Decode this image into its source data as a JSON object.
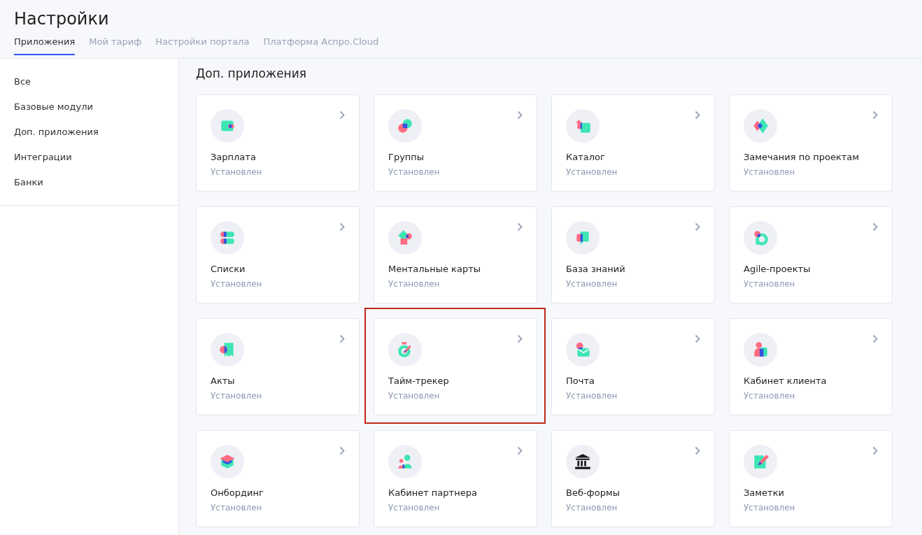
{
  "page_title": "Настройки",
  "tabs": [
    {
      "label": "Приложения",
      "selected": true
    },
    {
      "label": "Мой тариф",
      "selected": false
    },
    {
      "label": "Настройки портала",
      "selected": false
    },
    {
      "label": "Платформа Аспро.Cloud",
      "selected": false
    }
  ],
  "sidebar": {
    "items": [
      {
        "label": "Все",
        "selected": false
      },
      {
        "label": "Базовые модули",
        "selected": false
      },
      {
        "label": "Доп. приложения",
        "selected": false
      },
      {
        "label": "Интеграции",
        "selected": false
      },
      {
        "label": "Банки",
        "selected": false
      }
    ]
  },
  "section_title": "Доп. приложения",
  "apps": [
    {
      "name": "Зарплата",
      "status": "Установлен",
      "highlighted": false
    },
    {
      "name": "Группы",
      "status": "Установлен",
      "highlighted": false
    },
    {
      "name": "Каталог",
      "status": "Установлен",
      "highlighted": false
    },
    {
      "name": "Замечания по проектам",
      "status": "Установлен",
      "highlighted": false
    },
    {
      "name": "Списки",
      "status": "Установлен",
      "highlighted": false
    },
    {
      "name": "Ментальные карты",
      "status": "Установлен",
      "highlighted": false
    },
    {
      "name": "База знаний",
      "status": "Установлен",
      "highlighted": false
    },
    {
      "name": "Agile-проекты",
      "status": "Установлен",
      "highlighted": false
    },
    {
      "name": "Акты",
      "status": "Установлен",
      "highlighted": false
    },
    {
      "name": "Тайм-трекер",
      "status": "Установлен",
      "highlighted": true
    },
    {
      "name": "Почта",
      "status": "Установлен",
      "highlighted": false
    },
    {
      "name": "Кабинет клиента",
      "status": "Установлен",
      "highlighted": false
    },
    {
      "name": "Онбординг",
      "status": "Установлен",
      "highlighted": false
    },
    {
      "name": "Кабинет партнера",
      "status": "Установлен",
      "highlighted": false
    },
    {
      "name": "Веб-формы",
      "status": "Установлен",
      "highlighted": false
    },
    {
      "name": "Заметки",
      "status": "Установлен",
      "highlighted": false
    }
  ]
}
